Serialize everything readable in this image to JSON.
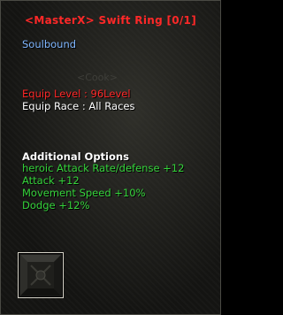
{
  "item": {
    "name": "<MasterX> Swift Ring [0/1]",
    "binding": "Soulbound",
    "crafter_watermark": "<Cook>",
    "equip_level": "Equip Level :  96Level",
    "equip_race": "Equip Race : All Races",
    "additional_header": "Additional Options",
    "options": [
      "heroic Attack Rate/defense +12",
      "Attack +12",
      "Movement Speed +10%",
      "Dodge  +12%"
    ],
    "icon": "ring-slot-icon"
  },
  "colors": {
    "name": "#ff2828",
    "binding": "#7fb6ff",
    "equip_level": "#ff2828",
    "equip_race": "#ffffff",
    "header": "#ffffff",
    "option": "#35d33b"
  }
}
